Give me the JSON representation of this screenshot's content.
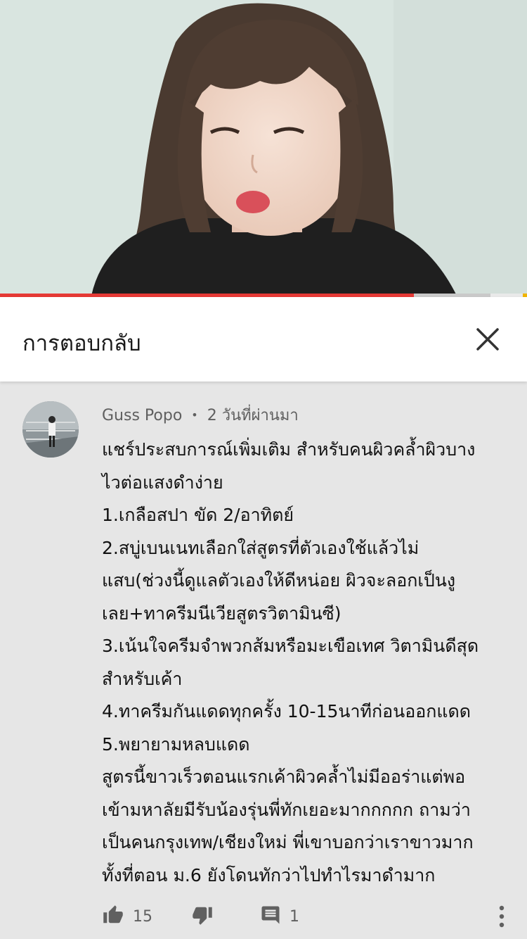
{
  "video": {
    "progress_played": 0.785,
    "progress_buffered": 0.93,
    "colors": {
      "played": "#e53935",
      "buffered": "#c9c9c9",
      "track": "#e9e9e9"
    }
  },
  "header": {
    "title": "การตอบกลับ",
    "close_icon": "close-icon"
  },
  "comment": {
    "author": "Guss Popo",
    "separator": "•",
    "time": "2 วันที่ผ่านมา",
    "lines": [
      "แชร์ประสบการณ์เพิ่มเติม สำหรับคนผิวคล้ำผิวบาง",
      "ไวต่อแสงดำง่าย",
      "1.เกลือสปา ขัด 2/อาทิตย์",
      "2.สบู่เบนเนทเลือกใส่สูตรที่ตัวเองใช้แล้วไม่",
      "แสบ(ช่วงนี้ดูแลตัวเองให้ดีหน่อย ผิวจะลอกเป็นงู",
      "เลย+ทาครีมนีเวียสูตรวิตามินซี)",
      "3.เน้นใจครีมจำพวกส้มหรือมะเขือเทศ วิตามินดีสุด",
      "สำหรับเค้า",
      "4.ทาครีมกันแดดทุกครั้ง 10-15นาทีก่อนออกแดด",
      "5.พยายามหลบแดด",
      "สูตรนี้ขาวเร็วตอนแรกเค้าผิวคล้ำไม่มีออร่าแต่พอ",
      "เข้ามหาลัยมีรับน้องรุ่นพี่ทักเยอะมากกกกก ถามว่า",
      "เป็นคนกรุงเทพ/เชียงใหม่ พี่เขาบอกว่าเราขาวมาก",
      "ทั้งที่ตอน ม.6 ยังโดนทักว่าไปทำไรมาดำมาก"
    ],
    "likes": "15",
    "replies": "1",
    "icons": {
      "like": "thumbs-up-icon",
      "dislike": "thumbs-down-icon",
      "reply": "reply-icon",
      "more": "more-vert-icon"
    }
  }
}
